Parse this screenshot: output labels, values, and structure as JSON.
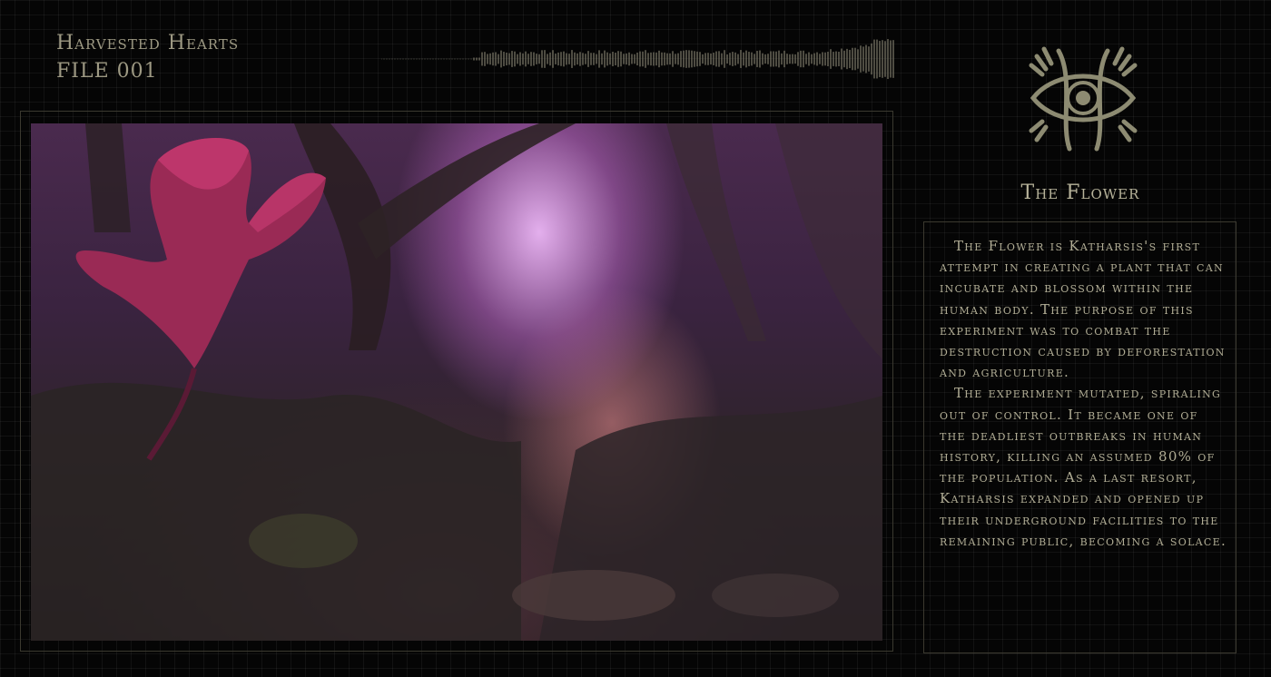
{
  "header": {
    "title": "Harvested Hearts",
    "file_label": "FILE 001"
  },
  "icons": {
    "waveform": "audio-waveform-icon",
    "emblem": "eye-emblem-icon"
  },
  "image": {
    "description_name": "pink-forest-with-flower-illustration"
  },
  "section": {
    "title": "The Flower",
    "paragraphs": [
      "The Flower is Katharsis's first attempt in creating a plant that can incubate and blossom within the human body. The purpose of this experiment was to combat the destruction caused by deforestation and agriculture.",
      "The experiment mutated, spiraling out of control. It became one of the deadliest outbreaks in human history, killing an assumed 80% of the population. As a last resort, Katharsis expanded and opened up their underground facilities to the remaining public, becoming a solace."
    ]
  },
  "colors": {
    "background": "#050505",
    "text": "#b1ad95",
    "accent": "#9d9983"
  }
}
